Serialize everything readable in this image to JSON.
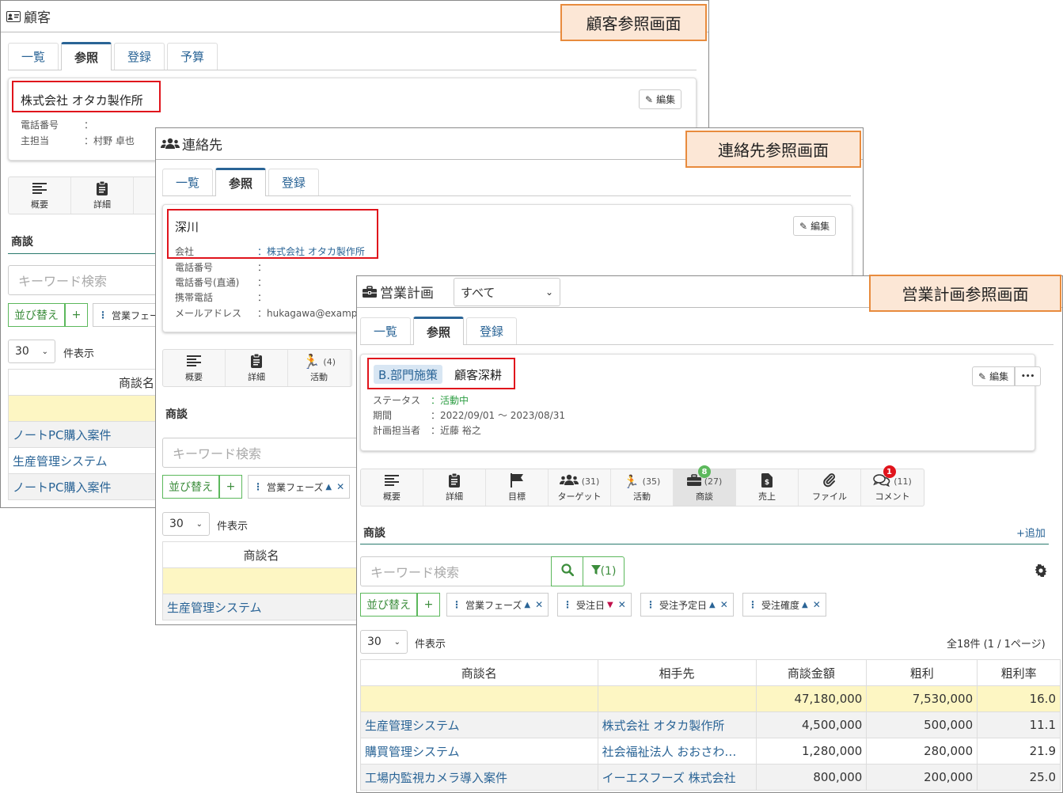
{
  "customer": {
    "title": "顧客",
    "label": "顧客参照画面",
    "tabs": [
      "一覧",
      "参照",
      "登録",
      "予算"
    ],
    "name": "株式会社 オタカ製作所",
    "edit": "編集",
    "fields": [
      {
        "k": "電話番号",
        "v": "："
      },
      {
        "k": "主担当",
        "v": "：村野 卓也"
      }
    ],
    "icons": [
      "概要",
      "詳細"
    ],
    "section": "商談",
    "search_placeholder": "キーワード検索",
    "sort": "並び替え",
    "add": "+",
    "chip": "営業フェー",
    "per_page": "30",
    "per_page_label": "件表示",
    "col": "商談名",
    "rows": [
      "ノートPC購入案件",
      "生産管理システム",
      "ノートPC購入案件"
    ]
  },
  "contact": {
    "title": "連絡先",
    "label": "連絡先参照画面",
    "tabs": [
      "一覧",
      "参照",
      "登録"
    ],
    "name": "深川",
    "edit": "編集",
    "company_k": "会社",
    "company_v": "：株式会社 オタカ製作所",
    "fields": [
      {
        "k": "電話番号",
        "v": "："
      },
      {
        "k": "電話番号(直通)",
        "v": "："
      },
      {
        "k": "携帯電話",
        "v": "："
      },
      {
        "k": "メールアドレス",
        "v": "：hukagawa@examp"
      }
    ],
    "icons": [
      {
        "label": "概要",
        "count": ""
      },
      {
        "label": "詳細",
        "count": ""
      },
      {
        "label": "活動",
        "count": "(4)"
      }
    ],
    "section": "商談",
    "search_placeholder": "キーワード検索",
    "sort": "並び替え",
    "add": "+",
    "chip": "営業フェーズ",
    "per_page": "30",
    "per_page_label": "件表示",
    "col": "商談名",
    "rows": [
      "生産管理システム"
    ]
  },
  "plan": {
    "title": "営業計画",
    "filter": "すべて",
    "label": "営業計画参照画面",
    "tabs": [
      "一覧",
      "参照",
      "登録"
    ],
    "tag": "B.部門施策",
    "name": "顧客深耕",
    "edit": "編集",
    "more": "•••",
    "fields": [
      {
        "k": "ステータス",
        "v": "：活動中"
      },
      {
        "k": "期間",
        "v": "：2022/09/01 ～ 2023/08/31"
      },
      {
        "k": "計画担当者",
        "v": "：近藤 裕之"
      }
    ],
    "icons": [
      {
        "label": "概要",
        "count": "",
        "icon": "align-left-icon"
      },
      {
        "label": "詳細",
        "count": "",
        "icon": "clipboard-icon"
      },
      {
        "label": "目標",
        "count": "",
        "icon": "flag-icon"
      },
      {
        "label": "ターゲット",
        "count": "(31)",
        "icon": "users-icon"
      },
      {
        "label": "活動",
        "count": "(35)",
        "icon": "running-icon"
      },
      {
        "label": "商談",
        "count": "(27)",
        "icon": "briefcase-icon"
      },
      {
        "label": "売上",
        "count": "",
        "icon": "invoice-icon"
      },
      {
        "label": "ファイル",
        "count": "",
        "icon": "paperclip-icon"
      },
      {
        "label": "コメント",
        "count": "(11)",
        "icon": "comments-icon"
      }
    ],
    "badge_deals": "8",
    "badge_comments": "1",
    "section": "商談",
    "add_link": "+追加",
    "search_placeholder": "キーワード検索",
    "filter_count": "(1)",
    "sort": "並び替え",
    "add": "+",
    "chips": [
      {
        "label": "営業フェーズ",
        "dir": "▲"
      },
      {
        "label": "受注日",
        "dir": "▼"
      },
      {
        "label": "受注予定日",
        "dir": "▲"
      },
      {
        "label": "受注確度",
        "dir": "▲"
      }
    ],
    "per_page": "30",
    "per_page_label": "件表示",
    "total": "全18件 (1 / 1ページ)",
    "columns": [
      "商談名",
      "相手先",
      "商談金額",
      "粗利",
      "粗利率"
    ],
    "summary": [
      "",
      "",
      "47,180,000",
      "7,530,000",
      "16.0"
    ],
    "rows": [
      [
        "生産管理システム",
        "株式会社 オタカ製作所",
        "4,500,000",
        "500,000",
        "11.1"
      ],
      [
        "購買管理システム",
        "社会福祉法人 おおさわ…",
        "1,280,000",
        "280,000",
        "21.9"
      ],
      [
        "工場内監視カメラ導入案件",
        "イーエスフーズ 株式会社",
        "800,000",
        "200,000",
        "25.0"
      ]
    ],
    "colors": {
      "accent": "#2a6496",
      "green": "#5cb85c",
      "red_badge": "#e0141c",
      "green_badge": "#5cb85c"
    }
  }
}
